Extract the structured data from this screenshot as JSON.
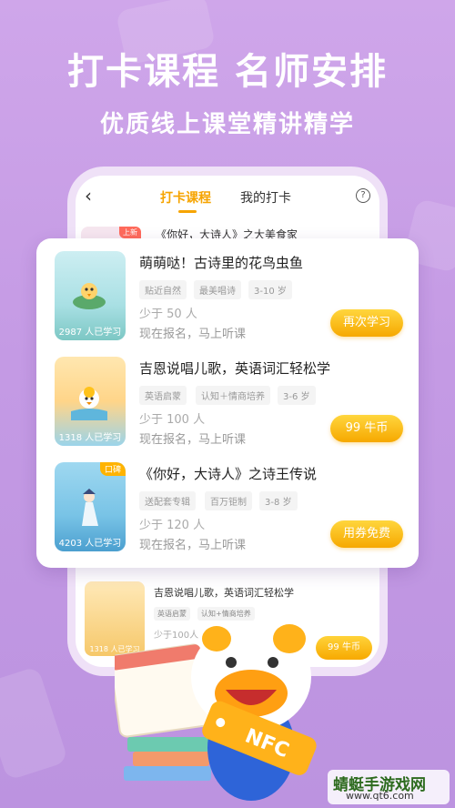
{
  "headline": "打卡课程  名师安排",
  "subline": "优质线上课堂精讲精学",
  "phone": {
    "back_icon": "‹",
    "tabs": [
      "打卡课程",
      "我的打卡"
    ],
    "help_icon": "?",
    "top_row": {
      "badge": "上新",
      "title": "《你好，大诗人》之大美食家"
    },
    "bottom_course": {
      "title": "吉恩说唱儿歌，英语词汇轻松学",
      "tags": [
        "英语启蒙",
        "认知+情商培养"
      ],
      "few": "少于100人",
      "count": "1318 人已学习",
      "price": "99 牛币"
    }
  },
  "courses": [
    {
      "title": "萌萌哒！古诗里的花鸟虫鱼",
      "tags": [
        "贴近自然",
        "最美唱诗",
        "3-10 岁"
      ],
      "few": "少于 50 人",
      "signup": "现在报名，马上听课",
      "count": "2987 人已学习",
      "cta": "再次学习",
      "badge": ""
    },
    {
      "title": "吉恩说唱儿歌，英语词汇轻松学",
      "tags": [
        "英语启蒙",
        "认知＋情商培养",
        "3-6 岁"
      ],
      "few": "少于 100 人",
      "signup": "现在报名，马上听课",
      "count": "1318 人已学习",
      "cta": "99 牛币",
      "badge": ""
    },
    {
      "title": "《你好，大诗人》之诗王传说",
      "tags": [
        "送配套专辑",
        "百万钜制",
        "3-8 岁"
      ],
      "few": "少于 120 人",
      "signup": "现在报名，马上听课",
      "count": "4203 人已学习",
      "cta": "用券免费",
      "badge": "口碑"
    }
  ],
  "mascot": {
    "tag_text": "NFC"
  },
  "watermark": {
    "title": "蜻蜓手游戏网",
    "url": "www.qt6.com"
  },
  "colors": {
    "accent": "#f6a800",
    "background": "#c79fe6",
    "tab_active": "#f6a400"
  }
}
